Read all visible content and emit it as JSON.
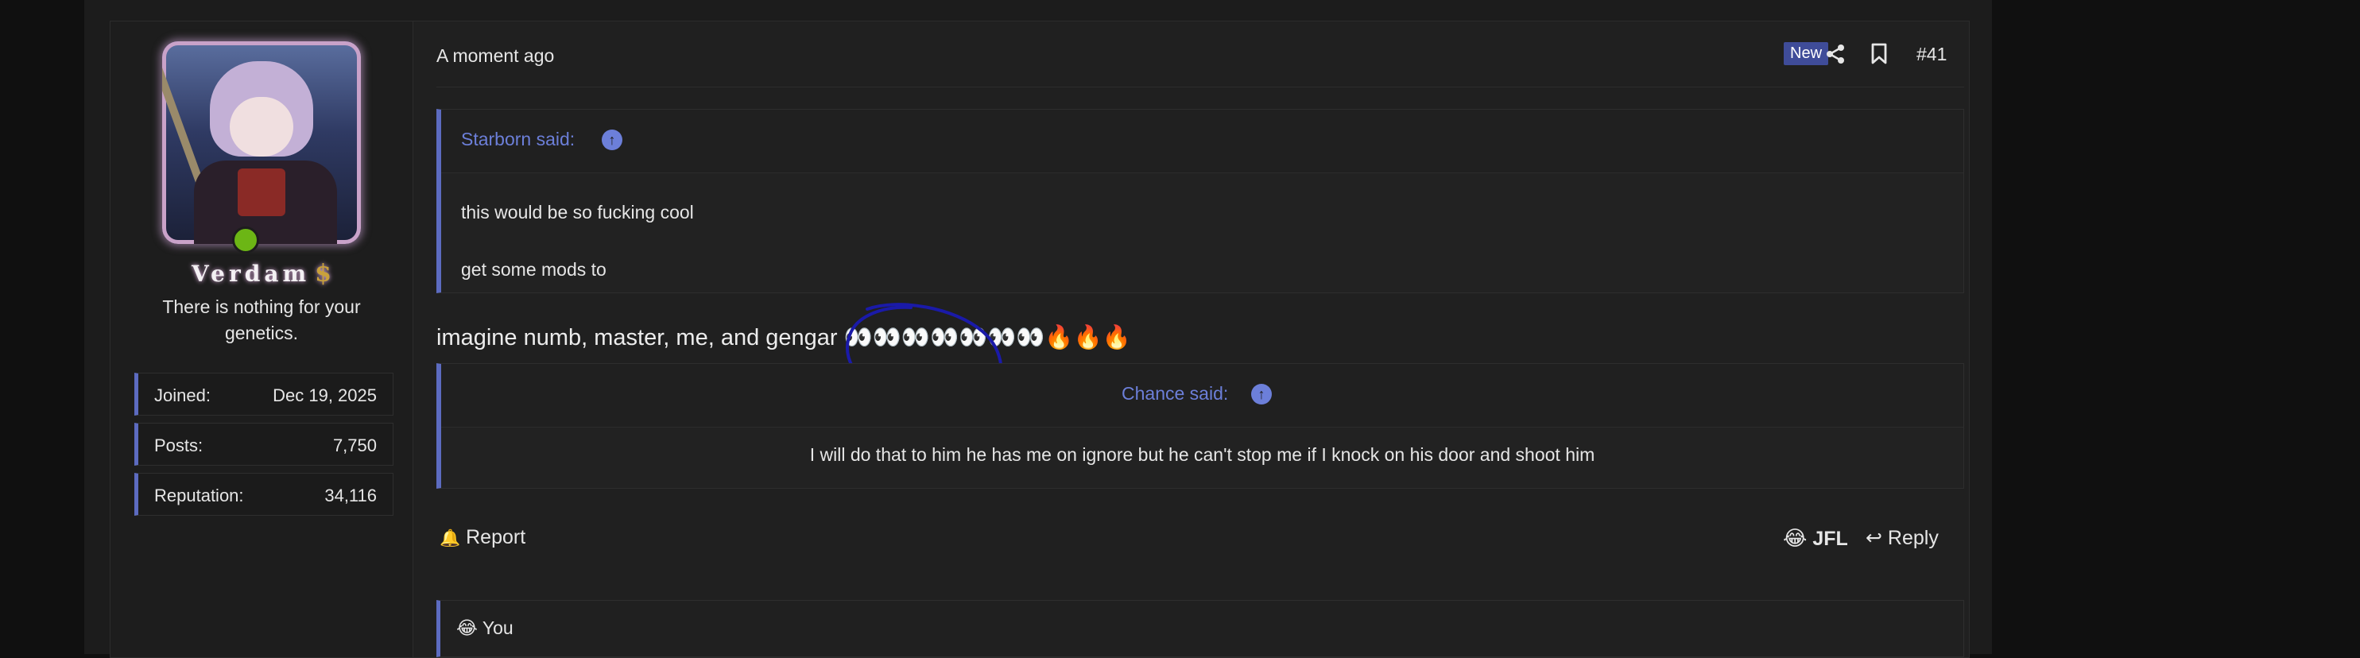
{
  "post": {
    "time": "A moment ago",
    "badge_new": "New",
    "post_number": "#41",
    "icons": {
      "share": "share-icon",
      "bookmark": "bookmark-icon"
    }
  },
  "user": {
    "name": "Verdam",
    "name_suffix_icon": "$",
    "title": "There is nothing for your genetics.",
    "online": true,
    "stats": [
      {
        "label": "Joined:",
        "value": "Dec 19, 2025"
      },
      {
        "label": "Posts:",
        "value": "7,750"
      },
      {
        "label": "Reputation:",
        "value": "34,116"
      }
    ]
  },
  "quote1": {
    "author": "Starborn said:",
    "lines": [
      "this would be so fucking cool",
      "get some mods to"
    ]
  },
  "body": {
    "text": "imagine numb, master, me, and gengar",
    "emoji_tail": "👀👀👀👀👀👀👀🔥🔥🔥"
  },
  "quote2": {
    "author": "Chance said:",
    "text": "I will do that to him he has me on ignore but he can't stop me if I knock on his door and shoot him"
  },
  "actions": {
    "report": "Report",
    "reaction": "JFL",
    "reply": "Reply"
  },
  "reactions_bar": {
    "emoji": "😂",
    "text": "You"
  },
  "colors": {
    "accent": "#5c6bc0",
    "quote_link": "#6c7fd9",
    "online": "#6cb615",
    "badge": "#3f4c99"
  }
}
